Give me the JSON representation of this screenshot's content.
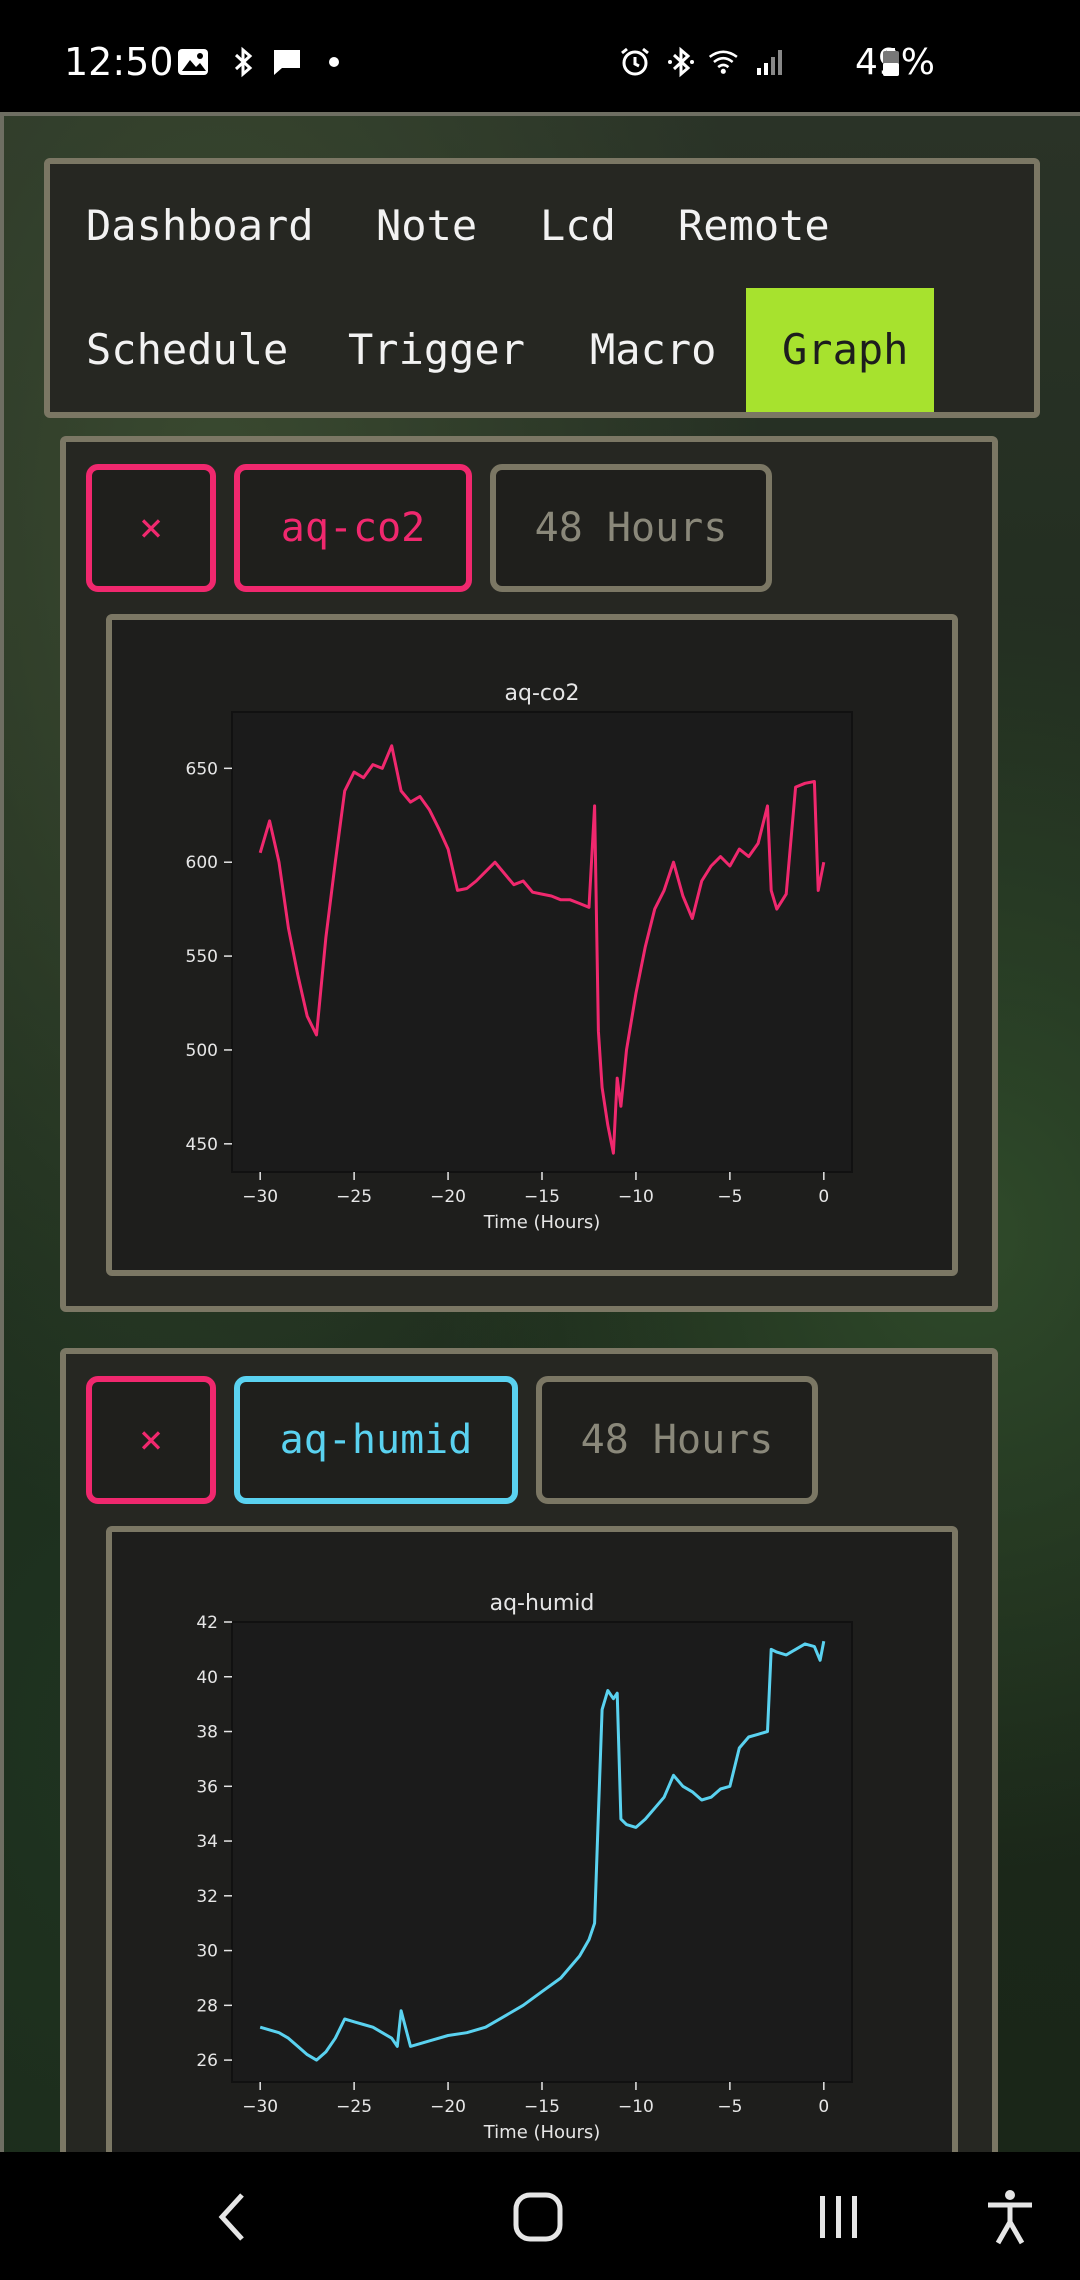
{
  "status_bar": {
    "time": "12:50",
    "battery": "49%"
  },
  "nav": {
    "tabs": [
      {
        "label": "Dashboard"
      },
      {
        "label": "Note"
      },
      {
        "label": "Lcd"
      },
      {
        "label": "Remote"
      },
      {
        "label": "Schedule"
      },
      {
        "label": "Trigger"
      },
      {
        "label": "Macro"
      },
      {
        "label": "Graph",
        "active": true
      }
    ]
  },
  "panels": [
    {
      "close_label": "×",
      "sensor_label": "aq-co2",
      "range_label": "48 Hours",
      "accent": "#f0286e"
    },
    {
      "close_label": "×",
      "sensor_label": "aq-humid",
      "range_label": "48 Hours",
      "accent": "#5ad2f0"
    }
  ],
  "chart_data": [
    {
      "type": "line",
      "title": "aq-co2",
      "xlabel": "Time (Hours)",
      "ylabel": "",
      "xlim": [
        -31.5,
        1.5
      ],
      "ylim": [
        435,
        680
      ],
      "xticks": [
        -30,
        -25,
        -20,
        -15,
        -10,
        -5,
        0
      ],
      "yticks": [
        450,
        500,
        550,
        600,
        650
      ],
      "color": "#f0286e",
      "x": [
        -30,
        -29.5,
        -29,
        -28.5,
        -28,
        -27.5,
        -27,
        -26.5,
        -26,
        -25.5,
        -25,
        -24.5,
        -24,
        -23.5,
        -23,
        -22.5,
        -22,
        -21.5,
        -21,
        -20.5,
        -20,
        -19.5,
        -19,
        -18.5,
        -18,
        -17.5,
        -17,
        -16.5,
        -16,
        -15.5,
        -15,
        -14.5,
        -14,
        -13.5,
        -13,
        -12.5,
        -12.2,
        -12,
        -11.8,
        -11.5,
        -11.2,
        -11,
        -10.8,
        -10.5,
        -10,
        -9.5,
        -9,
        -8.5,
        -8,
        -7.5,
        -7,
        -6.5,
        -6,
        -5.5,
        -5,
        -4.5,
        -4,
        -3.5,
        -3,
        -2.8,
        -2.5,
        -2,
        -1.5,
        -1,
        -0.5,
        -0.3,
        0
      ],
      "values": [
        605,
        622,
        600,
        565,
        540,
        518,
        508,
        560,
        600,
        638,
        648,
        645,
        652,
        650,
        662,
        638,
        632,
        635,
        628,
        618,
        607,
        585,
        586,
        590,
        595,
        600,
        594,
        588,
        590,
        584,
        583,
        582,
        580,
        580,
        578,
        576,
        630,
        510,
        480,
        460,
        445,
        485,
        470,
        500,
        530,
        555,
        575,
        585,
        600,
        582,
        570,
        590,
        598,
        603,
        598,
        607,
        603,
        610,
        630,
        585,
        575,
        583,
        640,
        642,
        643,
        585,
        600
      ]
    },
    {
      "type": "line",
      "title": "aq-humid",
      "xlabel": "Time (Hours)",
      "ylabel": "",
      "xlim": [
        -31.5,
        1.5
      ],
      "ylim": [
        25.2,
        42
      ],
      "xticks": [
        -30,
        -25,
        -20,
        -15,
        -10,
        -5,
        0
      ],
      "yticks": [
        26,
        28,
        30,
        32,
        34,
        36,
        38,
        40,
        42
      ],
      "color": "#5ad2f0",
      "x": [
        -30,
        -29,
        -28.5,
        -28,
        -27.5,
        -27,
        -26.5,
        -26,
        -25.5,
        -25,
        -24.5,
        -24,
        -23.5,
        -23,
        -22.7,
        -22.5,
        -22,
        -21,
        -20,
        -19,
        -18,
        -17,
        -16,
        -15,
        -14,
        -13,
        -12.5,
        -12.2,
        -12,
        -11.8,
        -11.5,
        -11.2,
        -11,
        -10.8,
        -10.5,
        -10,
        -9.5,
        -9,
        -8.5,
        -8,
        -7.5,
        -7,
        -6.5,
        -6,
        -5.5,
        -5,
        -4.5,
        -4,
        -3.5,
        -3,
        -2.8,
        -2.5,
        -2,
        -1.5,
        -1,
        -0.5,
        -0.2,
        0
      ],
      "values": [
        27.2,
        27.0,
        26.8,
        26.5,
        26.2,
        26.0,
        26.3,
        26.8,
        27.5,
        27.4,
        27.3,
        27.2,
        27.0,
        26.8,
        26.5,
        27.8,
        26.5,
        26.7,
        26.9,
        27.0,
        27.2,
        27.6,
        28.0,
        28.5,
        29.0,
        29.8,
        30.4,
        31.0,
        35.0,
        38.8,
        39.5,
        39.2,
        39.4,
        34.8,
        34.6,
        34.5,
        34.8,
        35.2,
        35.6,
        36.4,
        36.0,
        35.8,
        35.5,
        35.6,
        35.9,
        36.0,
        37.4,
        37.8,
        37.9,
        38.0,
        41.0,
        40.9,
        40.8,
        41.0,
        41.2,
        41.1,
        40.6,
        41.3
      ]
    }
  ]
}
